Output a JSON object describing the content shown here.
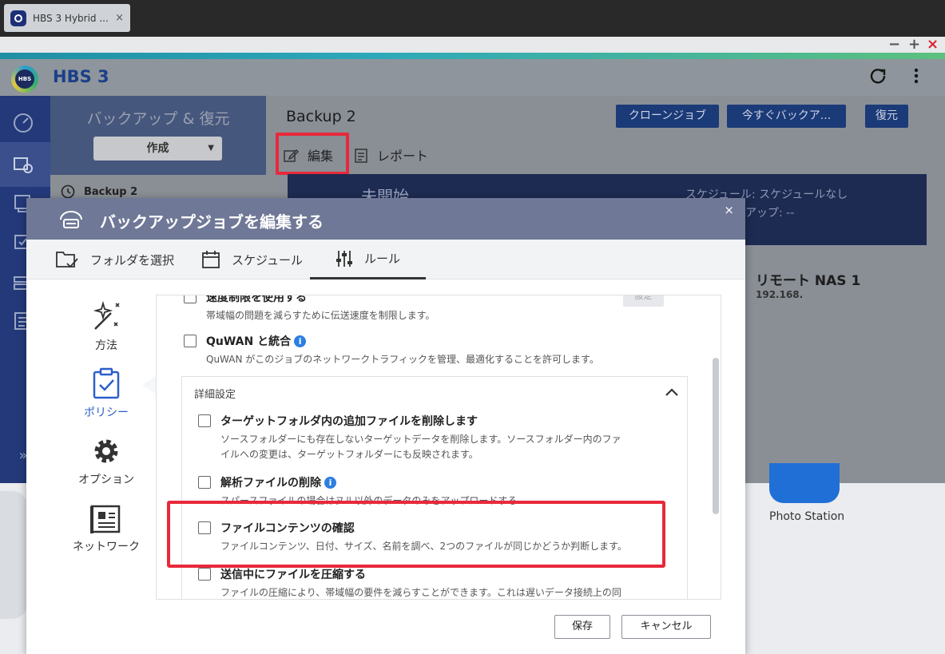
{
  "browser": {
    "tab_title": "HBS 3 Hybrid ...",
    "tab_close": "×",
    "min": "−",
    "max": "+",
    "close": "×"
  },
  "app": {
    "logo_text": "HBS",
    "title": "HBS 3"
  },
  "left_panel": {
    "title": "バックアップ & 復元",
    "create_label": "作成",
    "job_item": "Backup 2"
  },
  "main": {
    "job_name": "Backup 2",
    "clone_button": "クローンジョブ",
    "backup_now_button": "今すぐバックア...",
    "restore_button": "復元",
    "edit_label": "編集",
    "report_label": "レポート",
    "status": "未開始",
    "schedule_text": "スケジュール: スケジュールなし",
    "last_backup_text": "アップ: --",
    "remote_name": "リモート NAS 1",
    "remote_ip": "192.168."
  },
  "desktop": {
    "photo_station_label": "Photo Station"
  },
  "dialog": {
    "title": "バックアップジョブを編集する",
    "close": "×",
    "tabs": [
      "フォルダを選択",
      "スケジュール",
      "ルール"
    ],
    "nav": [
      "方法",
      "ポリシー",
      "オプション",
      "ネットワーク"
    ],
    "options": {
      "speed_limit": {
        "title": "速度制限を使用する",
        "desc": "帯域幅の問題を減らすために伝送速度を制限します。",
        "button": "設定"
      },
      "quwan": {
        "title": "QuWAN と統合",
        "desc": "QuWAN がこのジョブのネットワークトラフィックを管理、最適化することを許可します。"
      },
      "advanced_title": "詳細設定",
      "delete_extra": {
        "title": "ターゲットフォルダ内の追加ファイルを削除します",
        "desc1": "ソースフォルダーにも存在しないターゲットデータを削除します。ソースフォルダー内のファ",
        "desc2": "イルへの変更は、ターゲットフォルダーにも反映されます。"
      },
      "sparse": {
        "title": "解析ファイルの削除",
        "desc": "スパースファイルの場合はヌル以外のデータのみをアップロードする"
      },
      "verify": {
        "title": "ファイルコンテンツの確認",
        "desc": "ファイルコンテンツ、日付、サイズ、名前を調べ、2つのファイルが同じかどうか判断します。"
      },
      "compress": {
        "title": "送信中にファイルを圧縮する",
        "desc": "ファイルの圧縮により、帯域幅の要件を減らすことができます。これは遅いデータ接続上の同"
      }
    },
    "save_button": "保存",
    "cancel_button": "キャンセル"
  },
  "colors": {
    "accent": "#2c5fc9",
    "highlight": "#e8293b",
    "dialog_header": "#6f7896",
    "sidebar": "#23397a"
  }
}
